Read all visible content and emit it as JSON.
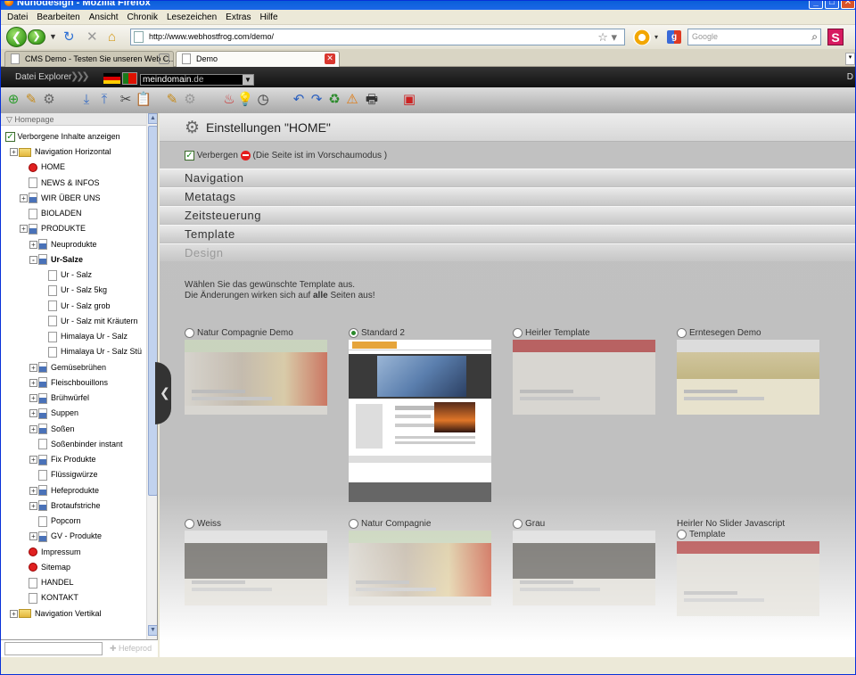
{
  "window": {
    "title": "Nunodesign - Mozilla Firefox"
  },
  "menu": [
    "Datei",
    "Bearbeiten",
    "Ansicht",
    "Chronik",
    "Lesezeichen",
    "Extras",
    "Hilfe"
  ],
  "nav": {
    "url": "http://www.webhostfrog.com/demo/",
    "search_placeholder": "Google"
  },
  "tabs": [
    {
      "label": "CMS Demo - Testen Sie unseren Web C..."
    },
    {
      "label": "Demo"
    }
  ],
  "app": {
    "datei_explorer": "Datei Explorer",
    "domain_name": "meindomain",
    "domain_tld": ".de",
    "right_char": "D"
  },
  "sidebar": {
    "header": "Homepage",
    "show_hidden": "Verborgene Inhalte anzeigen",
    "tree": [
      {
        "label": "Navigation Horizontal",
        "icon": "folder",
        "level": 0,
        "expander": "+"
      },
      {
        "label": "HOME",
        "icon": "red",
        "level": 1
      },
      {
        "label": "NEWS & INFOS",
        "icon": "page",
        "level": 1
      },
      {
        "label": "WIR ÜBER UNS",
        "icon": "dpage",
        "level": 1,
        "expander": "+"
      },
      {
        "label": "BIOLADEN",
        "icon": "page",
        "level": 1
      },
      {
        "label": "PRODUKTE",
        "icon": "dpage",
        "level": 1,
        "expander": "+"
      },
      {
        "label": "Neuprodukte",
        "icon": "dpage",
        "level": 2,
        "expander": "+"
      },
      {
        "label": "Ur-Salze",
        "icon": "dpage",
        "level": 2,
        "expander": "-",
        "bold": true
      },
      {
        "label": "Ur - Salz",
        "icon": "page",
        "level": 3
      },
      {
        "label": "Ur - Salz 5kg",
        "icon": "page",
        "level": 3
      },
      {
        "label": "Ur - Salz grob",
        "icon": "page",
        "level": 3
      },
      {
        "label": "Ur - Salz mit Kräutern",
        "icon": "page",
        "level": 3
      },
      {
        "label": "Himalaya Ur - Salz",
        "icon": "page",
        "level": 3
      },
      {
        "label": "Himalaya Ur - Salz Stü",
        "icon": "page",
        "level": 3
      },
      {
        "label": "Gemüsebrühen",
        "icon": "dpage",
        "level": 2,
        "expander": "+"
      },
      {
        "label": "Fleischbouillons",
        "icon": "dpage",
        "level": 2,
        "expander": "+"
      },
      {
        "label": "Brühwürfel",
        "icon": "dpage",
        "level": 2,
        "expander": "+"
      },
      {
        "label": "Suppen",
        "icon": "dpage",
        "level": 2,
        "expander": "+"
      },
      {
        "label": "Soßen",
        "icon": "dpage",
        "level": 2,
        "expander": "+"
      },
      {
        "label": "Soßenbinder instant",
        "icon": "page",
        "level": 2
      },
      {
        "label": "Fix Produkte",
        "icon": "dpage",
        "level": 2,
        "expander": "+"
      },
      {
        "label": "Flüssigwürze",
        "icon": "page",
        "level": 2
      },
      {
        "label": "Hefeprodukte",
        "icon": "dpage",
        "level": 2,
        "expander": "+"
      },
      {
        "label": "Brotaufstriche",
        "icon": "dpage",
        "level": 2,
        "expander": "+"
      },
      {
        "label": "Popcorn",
        "icon": "page",
        "level": 2
      },
      {
        "label": "GV - Produkte",
        "icon": "dpage",
        "level": 2,
        "expander": "+"
      },
      {
        "label": "Impressum",
        "icon": "red",
        "level": 1
      },
      {
        "label": "Sitemap",
        "icon": "red",
        "level": 1
      },
      {
        "label": "HANDEL",
        "icon": "page",
        "level": 1
      },
      {
        "label": "KONTAKT",
        "icon": "page",
        "level": 1
      },
      {
        "label": "Navigation Vertikal",
        "icon": "folder",
        "level": 0,
        "expander": "+"
      }
    ],
    "ghost_item": "Hefeprod"
  },
  "main": {
    "title": "Einstellungen \"HOME\"",
    "hide_label": "Verbergen",
    "preview_note": "(Die Seite ist im Vorschaumodus )",
    "sections": [
      "Navigation",
      "Metatags",
      "Zeitsteuerung",
      "Template",
      "Design"
    ],
    "desc_line1": "Wählen Sie das gewünschte Template aus.",
    "desc_line2_pre": "Die Änderungen wirken sich auf ",
    "desc_line2_bold": "alle",
    "desc_line2_post": " Seiten aus!",
    "templates": [
      {
        "label": "Natur Compagnie Demo",
        "style": "green",
        "selected": false
      },
      {
        "label": "Standard 2",
        "style": "sel",
        "selected": true
      },
      {
        "label": "Heirler Template",
        "style": "red",
        "selected": false
      },
      {
        "label": "Erntesegen Demo",
        "style": "yellow",
        "selected": false
      },
      {
        "label": "Weiss",
        "style": "dark",
        "selected": false
      },
      {
        "label": "Natur Compagnie",
        "style": "green",
        "selected": false
      },
      {
        "label": "Grau",
        "style": "dark",
        "selected": false
      },
      {
        "label": "Heirler No Slider Javascript",
        "label2": "Template",
        "style": "red",
        "selected": false
      }
    ]
  }
}
